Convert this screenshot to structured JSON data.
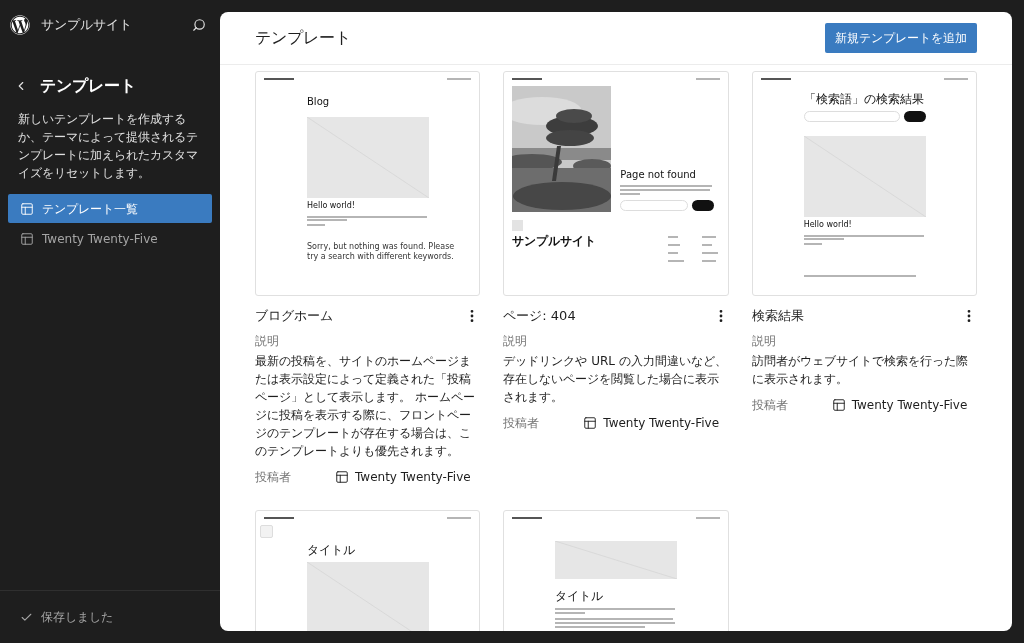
{
  "site": {
    "name": "サンプルサイト"
  },
  "sidebar": {
    "title": "テンプレート",
    "description": "新しいテンプレートを作成するか、テーマによって提供されるテンプレートに加えられたカスタマイズをリセットします。",
    "items": [
      {
        "label": "テンプレート一覧",
        "selected": true
      },
      {
        "label": "Twenty Twenty-Five",
        "selected": false
      }
    ],
    "status": "保存しました"
  },
  "page": {
    "title": "テンプレート",
    "add_button": "新規テンプレートを追加"
  },
  "templates": [
    {
      "name": "ブログホーム",
      "description_label": "説明",
      "description": "最新の投稿を、サイトのホームページまたは表示設定によって定義された「投稿ページ」として表示します。 ホームページに投稿を表示する際に、フロントページのテンプレートが存在する場合は、このテンプレートよりも優先されます。",
      "author_label": "投稿者",
      "author": "Twenty Twenty-Five",
      "preview": {
        "kind": "blog",
        "heading": "Blog",
        "post_title": "Hello world!",
        "empty_text": "Sorry, but nothing was found. Please try a search with different keywords."
      }
    },
    {
      "name": "ページ: 404",
      "description_label": "説明",
      "description": "デッドリンクや URL の入力間違いなど、存在しないページを閲覧した場合に表示されます。",
      "author_label": "投稿者",
      "author": "Twenty Twenty-Five",
      "preview": {
        "kind": "notfound",
        "heading": "Page not found",
        "footer_site": "サンプルサイト"
      }
    },
    {
      "name": "検索結果",
      "description_label": "説明",
      "description": "訪問者がウェブサイトで検索を行った際に表示されます。",
      "author_label": "投稿者",
      "author": "Twenty Twenty-Five",
      "preview": {
        "kind": "search",
        "heading": "「検索語」の検索結果",
        "post_title": "Hello world!"
      }
    },
    {
      "checked": false,
      "preview": {
        "kind": "single",
        "heading": "タイトル"
      }
    },
    {
      "preview": {
        "kind": "page",
        "heading": "タイトル"
      }
    }
  ]
}
